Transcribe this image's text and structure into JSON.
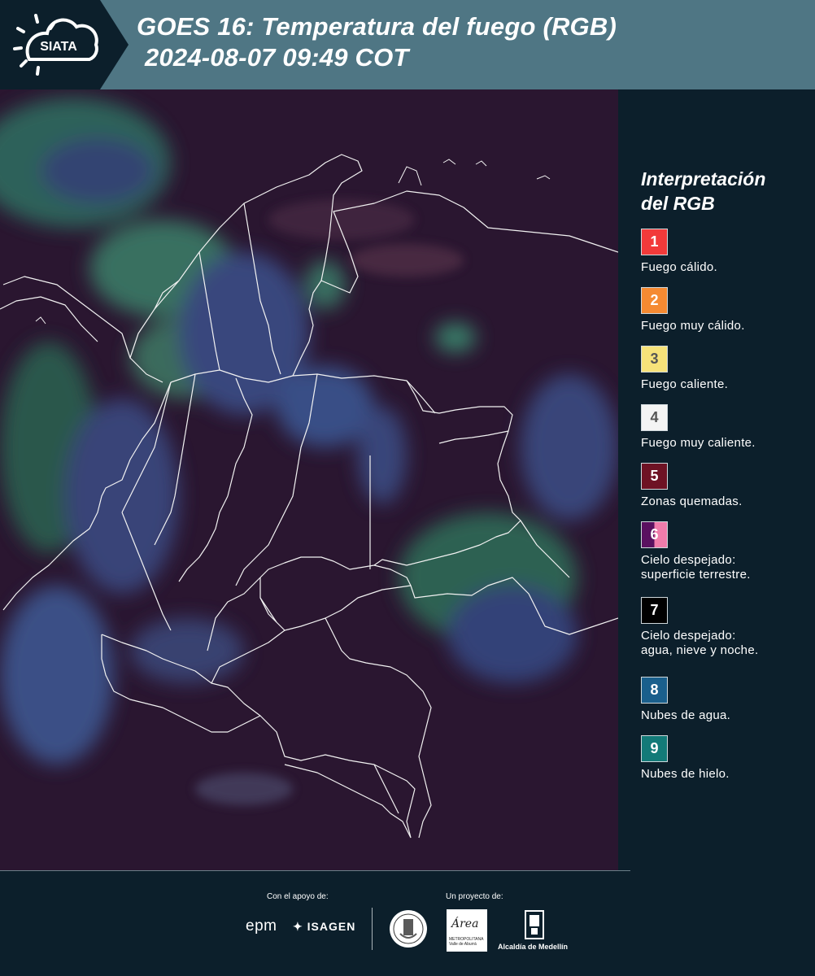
{
  "header": {
    "logo_text": "SIATA",
    "title_line1": "GOES 16: Temperatura del fuego (RGB)",
    "title_line2": "2024-08-07 09:49 COT"
  },
  "legend": {
    "title_line1": "Interpretación",
    "title_line2": "del RGB",
    "items": [
      {
        "number": "1",
        "label": "Fuego cálido.",
        "color": "#f23a3a",
        "number_color": "#ffffff"
      },
      {
        "number": "2",
        "label": "Fuego muy cálido.",
        "color": "#f58a32",
        "number_color": "#ffffff"
      },
      {
        "number": "3",
        "label": "Fuego caliente.",
        "color": "#f6e27a",
        "number_color": "#555555"
      },
      {
        "number": "4",
        "label": "Fuego muy caliente.",
        "color": "#f4f4f4",
        "number_color": "#555555"
      },
      {
        "number": "5",
        "label": "Zonas quemadas.",
        "color": "#6e1224",
        "number_color": "#ffffff"
      },
      {
        "number": "6",
        "label_line1": "Cielo despejado:",
        "label_line2": "superficie terrestre.",
        "color": "#5a1160",
        "color2": "#f07cab",
        "number_color": "#ffffff"
      },
      {
        "number": "7",
        "label_line1": "Cielo despejado:",
        "label_line2": "agua, nieve y noche.",
        "color": "#000000",
        "number_color": "#ffffff"
      },
      {
        "number": "8",
        "label": "Nubes de agua.",
        "color": "#1a5f8c",
        "number_color": "#ffffff"
      },
      {
        "number": "9",
        "label": "Nubes de hielo.",
        "color": "#137a78",
        "number_color": "#ffffff"
      }
    ]
  },
  "footer": {
    "support_label": "Con el apoyo de:",
    "project_label": "Un proyecto de:",
    "sponsor1": "epm",
    "sponsor2": "ISAGEN",
    "area_logo_word": "Área",
    "area_logo_sub": "METROPOLITANA Valle de Aburrá",
    "alcaldia": "Alcaldía de Medellín"
  },
  "colors": {
    "background": "#0c1f2b",
    "header_band": "#4f7684",
    "map_base": "#2b1730"
  }
}
